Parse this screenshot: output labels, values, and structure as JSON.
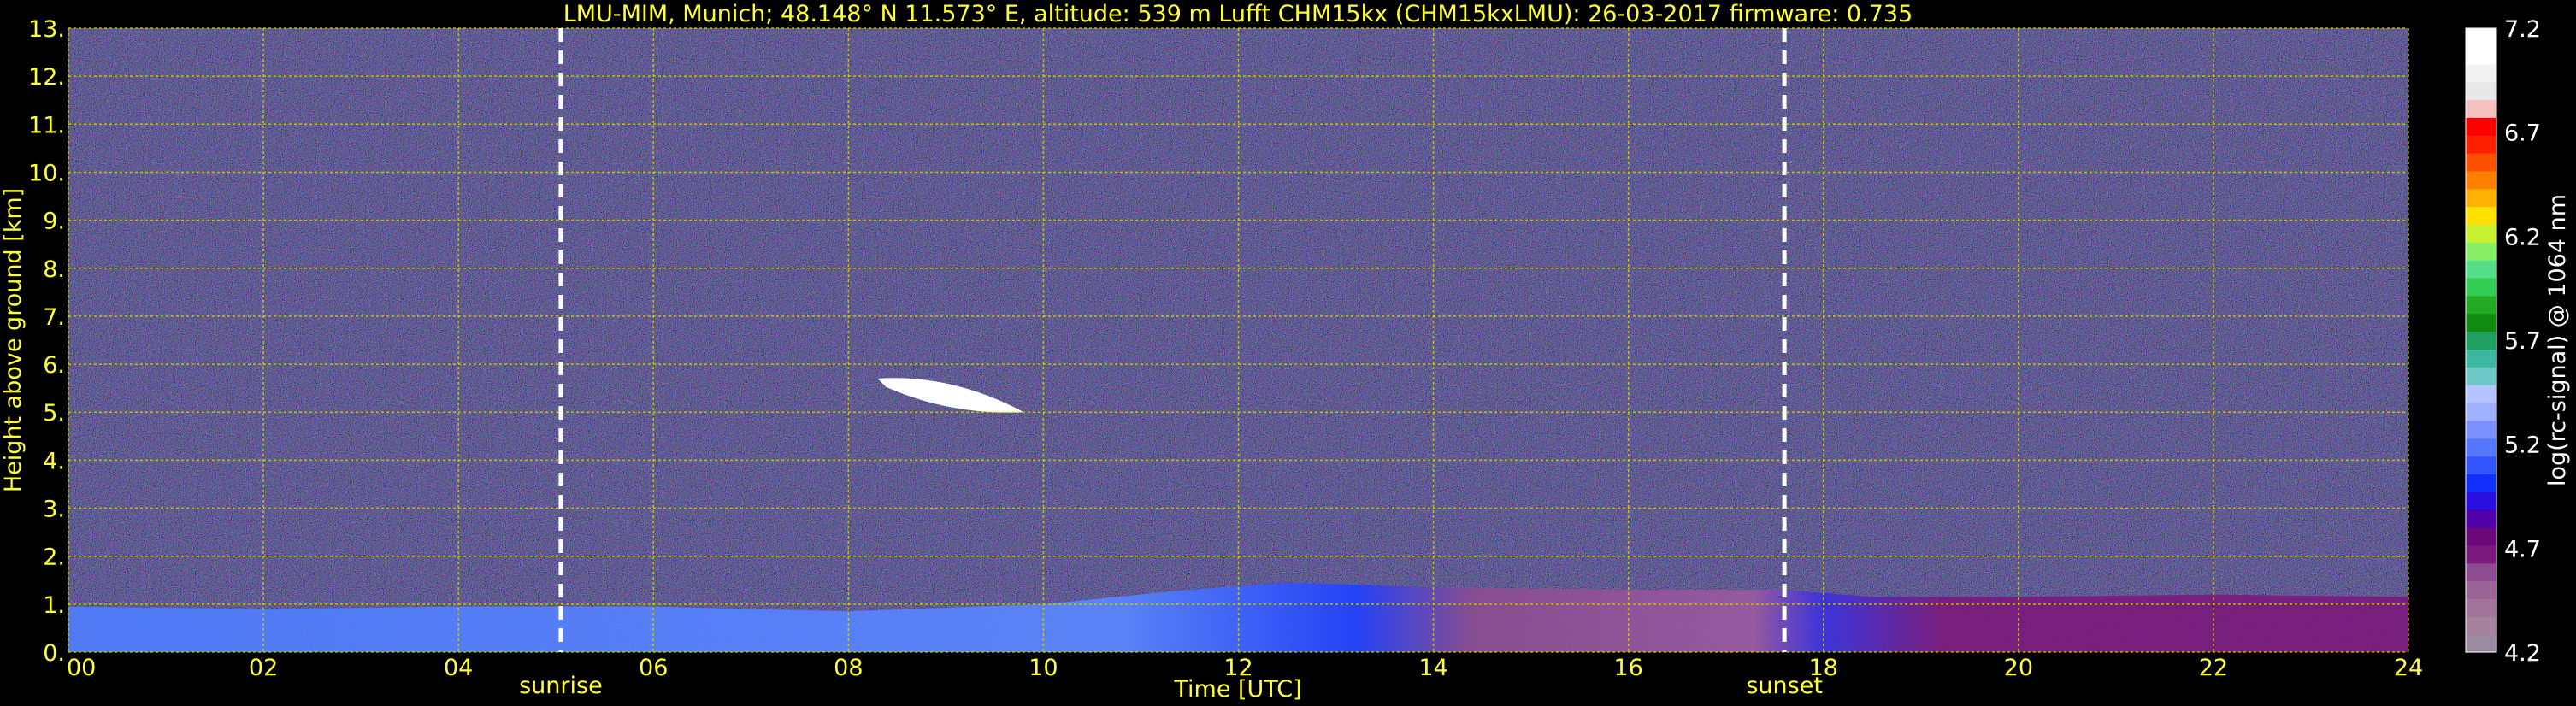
{
  "chart_data": {
    "type": "heatmap",
    "title": "LMU-MIM, Munich; 48.148° N 11.573° E, altitude: 539 m    Lufft CHM15kx (CHM15kxLMU): 26-03-2017    firmware: 0.735",
    "xlabel": "Time [UTC]",
    "ylabel": "Height above ground [km]",
    "xlim": [
      0,
      24
    ],
    "ylim": [
      0,
      13
    ],
    "x_ticks": [
      "00",
      "02",
      "04",
      "06",
      "08",
      "10",
      "12",
      "14",
      "16",
      "18",
      "20",
      "22",
      "24"
    ],
    "y_ticks": [
      "0.",
      "1.",
      "2.",
      "3.",
      "4.",
      "5.",
      "6.",
      "7.",
      "8.",
      "9.",
      "10.",
      "11.",
      "12.",
      "13."
    ],
    "grid": true,
    "markers": [
      {
        "label": "sunrise",
        "x": 5.05
      },
      {
        "label": "sunset",
        "x": 17.6
      }
    ],
    "features": {
      "boundary_layer": [
        {
          "x": 0,
          "top": 0.95
        },
        {
          "x": 2,
          "top": 0.9
        },
        {
          "x": 4,
          "top": 0.95
        },
        {
          "x": 6,
          "top": 0.95
        },
        {
          "x": 8,
          "top": 0.85
        },
        {
          "x": 10,
          "top": 1.0
        },
        {
          "x": 11.5,
          "top": 1.3
        },
        {
          "x": 12.5,
          "top": 1.45
        },
        {
          "x": 14,
          "top": 1.35
        },
        {
          "x": 16,
          "top": 1.3
        },
        {
          "x": 17.6,
          "top": 1.3
        },
        {
          "x": 18.5,
          "top": 1.15
        },
        {
          "x": 20,
          "top": 1.15
        },
        {
          "x": 22,
          "top": 1.2
        },
        {
          "x": 24,
          "top": 1.15
        }
      ],
      "cloud_layer": {
        "x_start": 8.3,
        "x_end": 9.8,
        "y_start": 5.7,
        "y_end": 5.0
      }
    },
    "colorbar": {
      "label": "log(rc-signal) @ 1064 nm",
      "range": [
        4.2,
        7.2
      ],
      "ticks": [
        "7.2",
        "6.7",
        "6.2",
        "5.7",
        "5.2",
        "4.7",
        "4.2"
      ],
      "colors_bottom_to_top": [
        "#9b8aa0",
        "#a6819b",
        "#a2749a",
        "#9b6496",
        "#8c4c8f",
        "#7a1a7d",
        "#6a0a7a",
        "#4f00a8",
        "#2b0ee0",
        "#1030ff",
        "#3355ff",
        "#5577ff",
        "#7b8fff",
        "#9fb0ff",
        "#b5c4ff",
        "#6fc8c8",
        "#3cb8a0",
        "#20a060",
        "#108a10",
        "#22aa22",
        "#33cc55",
        "#55dd88",
        "#88ee66",
        "#c8f030",
        "#ffe000",
        "#ffb000",
        "#ff8000",
        "#ff5000",
        "#ff2000",
        "#ff0000",
        "#f4c0c0",
        "#e8e8e8",
        "#f2f2f2",
        "#ffffff",
        "#ffffff"
      ]
    }
  }
}
